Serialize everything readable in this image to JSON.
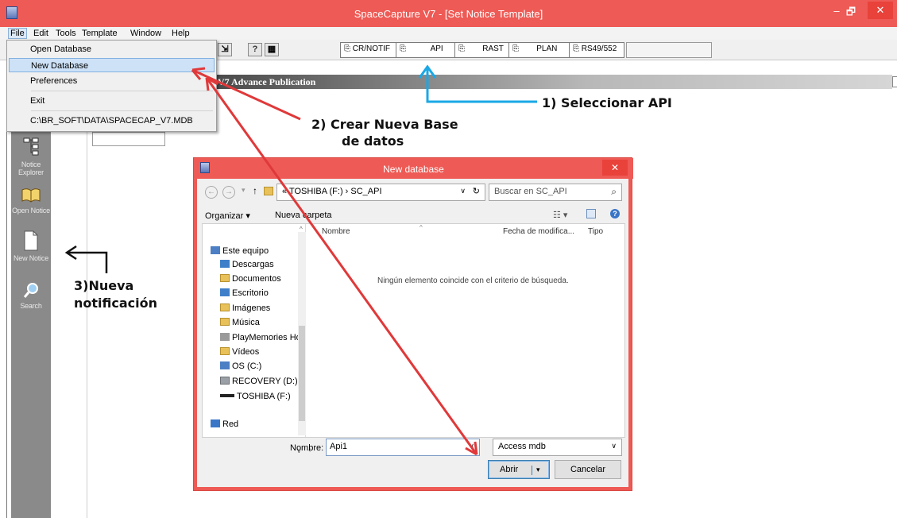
{
  "window": {
    "title": "SpaceCapture V7 - [Set Notice Template]",
    "minimize": "–",
    "maximize": "🗗",
    "close": "✕"
  },
  "menu": {
    "file": "File",
    "edit": "Edit",
    "tools": "Tools",
    "template": "Template",
    "window": "Window",
    "help": "Help"
  },
  "file_menu": {
    "items": [
      "Open Database",
      "New Database",
      "Preferences",
      "Exit",
      "C:\\BR_SOFT\\DATA\\SPACECAP_V7.MDB"
    ],
    "highlighted": "New Database"
  },
  "toolbar": {
    "tabs": [
      "CR/NOTIF",
      "API",
      "RAST",
      "PLAN",
      "RS49/552"
    ],
    "help_glyph": "?"
  },
  "header_bar": {
    "text": "V7 Advance Publication"
  },
  "sidebar": {
    "items": [
      "Notice Explorer",
      "Open Notice",
      "New Notice",
      "Search"
    ]
  },
  "annotations": {
    "step1": "1)  Seleccionar API",
    "step2_line1": "2)  Crear Nueva Base",
    "step2_line2": "de datos",
    "step3_line1": "3)Nueva",
    "step3_line2": "notificación",
    "colors": {
      "red_arrow": "#e0393a",
      "blue_arrow": "#1aa8e6",
      "black_arrow": "#111111"
    }
  },
  "dialog": {
    "title": "New database",
    "close": "✕",
    "nav": {
      "back": "←",
      "forward": "→",
      "up": "↑"
    },
    "path": "« TOSHIBA (F:) › SC_API",
    "search_placeholder": "Buscar en SC_API",
    "organize": "Organizar ▾",
    "new_folder": "Nueva carpeta",
    "tree": [
      "Este equipo",
      "Descargas",
      "Documentos",
      "Escritorio",
      "Imágenes",
      "Música",
      "PlayMemories Ho",
      "Vídeos",
      "OS (C:)",
      "RECOVERY (D:)",
      "TOSHIBA (F:)",
      "Red"
    ],
    "columns": {
      "name": "Nombre",
      "date": "Fecha de modifica...",
      "type": "Tipo"
    },
    "empty_message": "Ningún elemento coincide con el criterio de búsqueda.",
    "filename_label": "Nombre:",
    "filename_value": "Api1",
    "file_type": "Access mdb",
    "open_button": "Abrir",
    "cancel_button": "Cancelar"
  }
}
